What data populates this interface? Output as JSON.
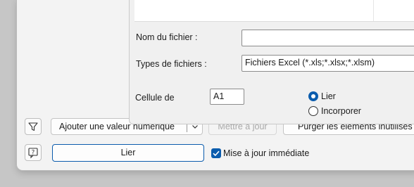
{
  "file_dialog": {
    "file_name_label": "Nom du fichier :",
    "file_name_value": "",
    "file_types_label": "Types de fichiers :",
    "file_types_value": "Fichiers Excel (*.xls;*.xlsx;*.xlsm)",
    "cell_label": "Cellule de",
    "cell_value": "A1",
    "mode_options": [
      {
        "label": "Lier",
        "selected": true
      },
      {
        "label": "Incorporer",
        "selected": false
      }
    ]
  },
  "toolbar": {
    "filter_icon": "funnel-icon",
    "add_value_label": "Ajouter une valeur numérique",
    "update_label": "Mettre à jour",
    "purge_label": "Purger les éléments inutilisés"
  },
  "footer": {
    "help_icon": "help-icon",
    "link_button_label": "Lier",
    "auto_update_label": "Mise à jour immédiate",
    "auto_update_checked": true
  },
  "colors": {
    "accent": "#0b5cad"
  }
}
